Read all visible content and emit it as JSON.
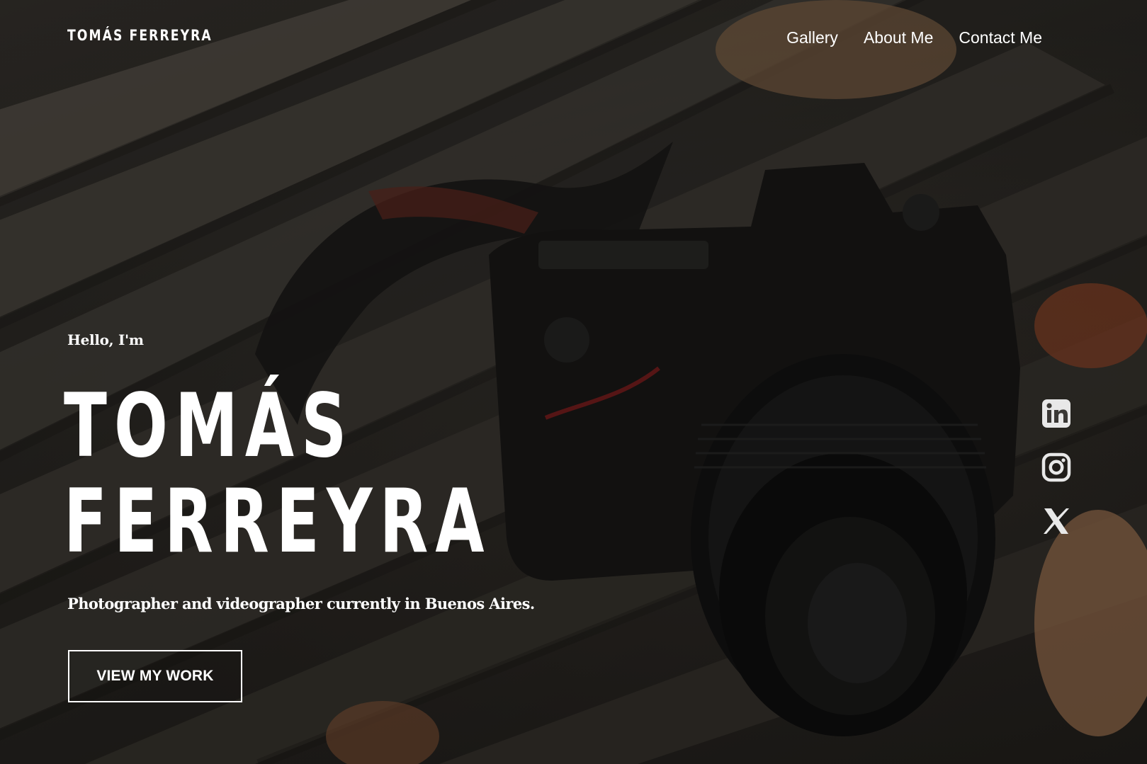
{
  "header": {
    "brand": "TOMÁS FERREYRA",
    "nav": [
      {
        "label": "Gallery"
      },
      {
        "label": "About Me"
      },
      {
        "label": "Contact Me"
      }
    ]
  },
  "hero": {
    "greeting": "Hello, I'm",
    "name_line1": "TOMÁS",
    "name_line2": "FERREYRA",
    "tagline": "Photographer and videographer currently in Buenos Aires.",
    "cta_label": "VIEW MY WORK"
  },
  "social": [
    {
      "icon": "linkedin-icon"
    },
    {
      "icon": "instagram-icon"
    },
    {
      "icon": "x-icon"
    }
  ],
  "colors": {
    "text": "#ffffff",
    "overlay": "#000000"
  }
}
